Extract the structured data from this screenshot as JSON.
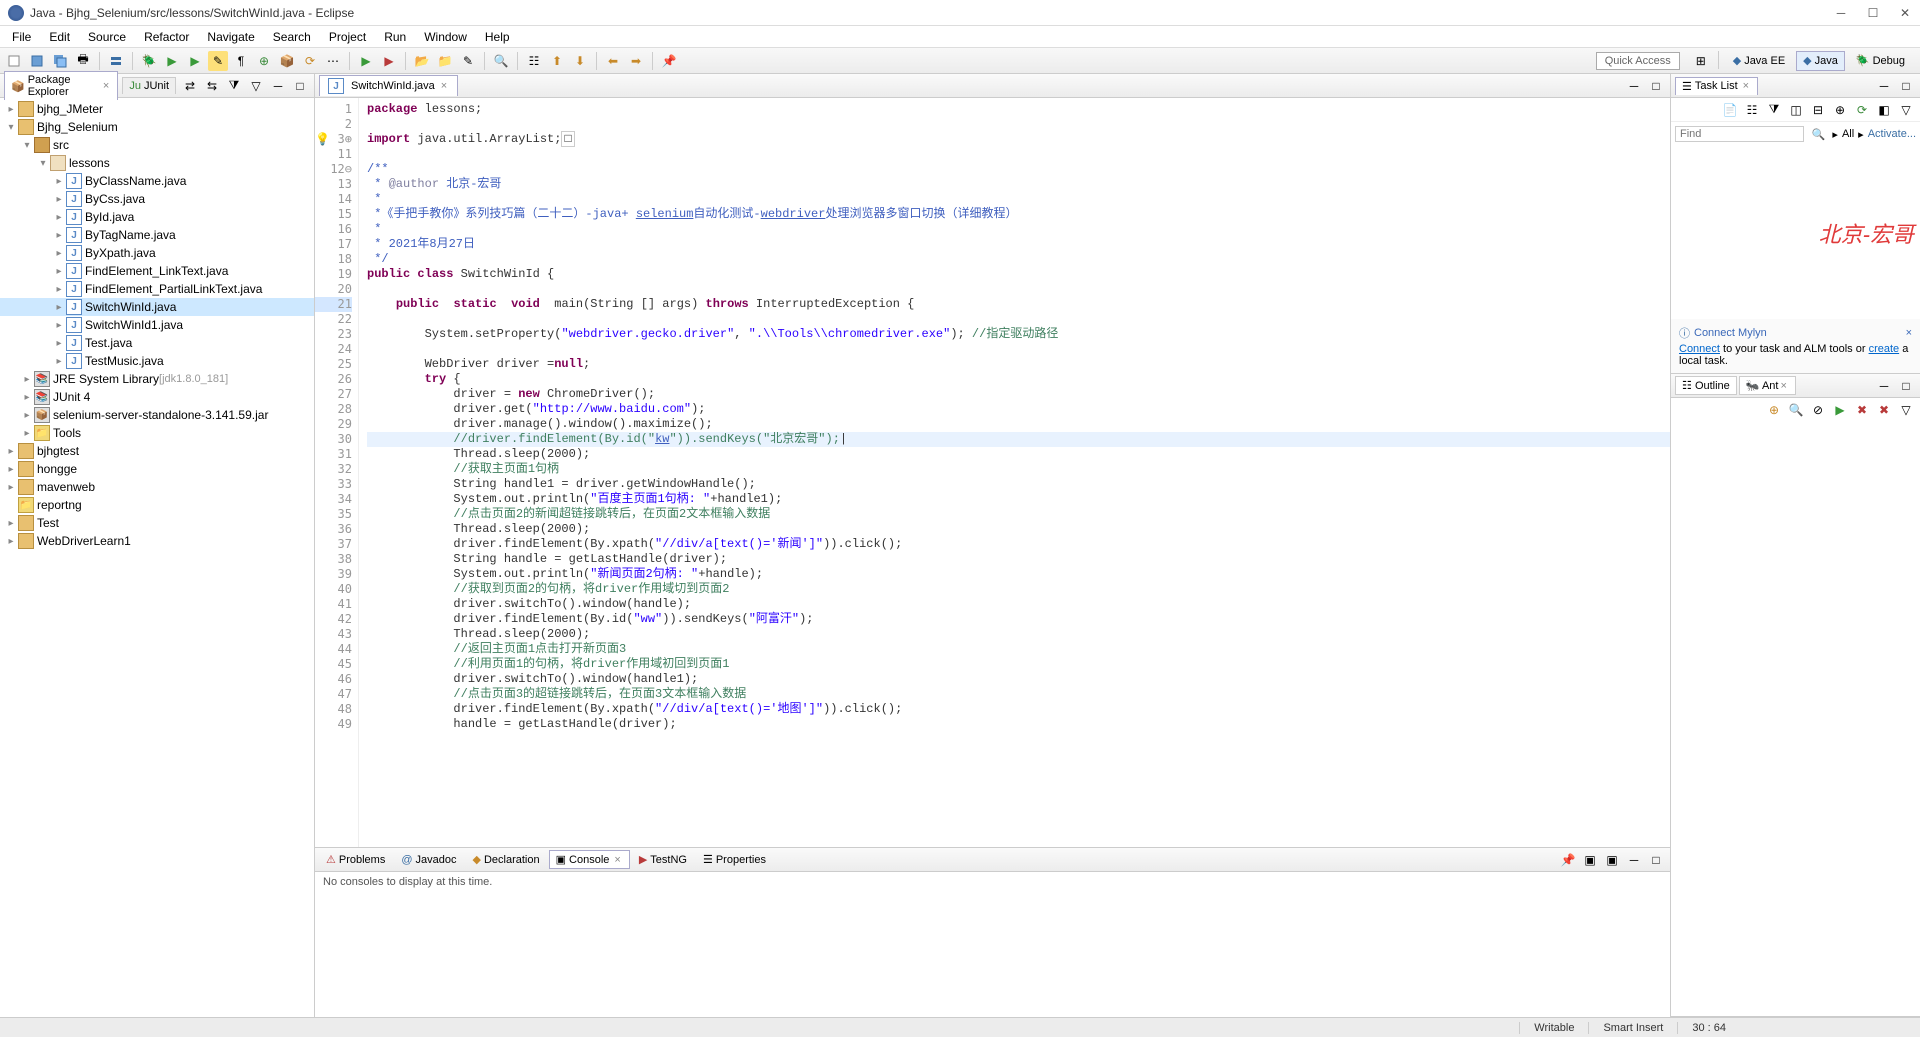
{
  "window": {
    "title": "Java - Bjhg_Selenium/src/lessons/SwitchWinId.java - Eclipse"
  },
  "menus": [
    "File",
    "Edit",
    "Source",
    "Refactor",
    "Navigate",
    "Search",
    "Project",
    "Run",
    "Window",
    "Help"
  ],
  "quick_access": "Quick Access",
  "perspectives": [
    {
      "label": "Java EE"
    },
    {
      "label": "Java"
    },
    {
      "label": "Debug"
    }
  ],
  "left": {
    "tab1": "Package Explorer",
    "tab2": "JUnit",
    "tree": {
      "p1": "bjhg_JMeter",
      "p2": "Bjhg_Selenium",
      "src": "src",
      "pkg": "lessons",
      "files": [
        "ByClassName.java",
        "ByCss.java",
        "ById.java",
        "ByTagName.java",
        "ByXpath.java",
        "FindElement_LinkText.java",
        "FindElement_PartialLinkText.java",
        "SwitchWinId.java",
        "SwitchWinId1.java",
        "Test.java",
        "TestMusic.java"
      ],
      "jre": "JRE System Library",
      "jre_deco": "[jdk1.8.0_181]",
      "junit": "JUnit 4",
      "selenium": "selenium-server-standalone-3.141.59.jar",
      "tools": "Tools",
      "others": [
        "bjhgtest",
        "hongge",
        "mavenweb",
        "reportng",
        "Test",
        "WebDriverLearn1"
      ]
    }
  },
  "editor": {
    "tab": "SwitchWinId.java",
    "lines": {
      "start": 1,
      "visible": [
        1,
        2,
        3,
        11,
        12,
        13,
        14,
        15,
        16,
        17,
        18,
        19,
        20,
        21,
        22,
        23,
        24,
        25,
        26,
        27,
        28,
        29,
        30,
        31,
        32,
        33,
        34,
        35,
        36,
        37,
        38,
        39,
        40,
        41,
        42,
        43,
        44,
        45,
        46,
        47,
        48,
        49
      ]
    },
    "code": {
      "l1_k": "package",
      "l1_t": " lessons;",
      "l3a": "import",
      "l3b": " java.util.ArrayList;",
      "l12": "/**",
      "l13a": " * ",
      "l13b": "@author",
      "l13c": " 北京-宏哥",
      "l14": " *",
      "l15a": " *《手把手教你》系列技巧篇（二十二）-java+ ",
      "l15b": "selenium",
      "l15c": "自动化测试-",
      "l15d": "webdriver",
      "l15e": "处理浏览器多窗口切换（详细教程）",
      "l16": " *",
      "l17": " * 2021年8月27日",
      "l18": " */",
      "l19a": "public",
      "l19b": "class",
      "l19c": " SwitchWinId {",
      "l21a": "public",
      "l21b": "static",
      "l21c": "void",
      "l21d": "  main(String [] args) ",
      "l21e": "throws",
      "l21f": " InterruptedException {",
      "l23a": "        System.setProperty(",
      "l23b": "\"webdriver.gecko.driver\"",
      "l23c": ", ",
      "l23d": "\".\\\\Tools\\\\chromedriver.exe\"",
      "l23e": "); ",
      "l23f": "//指定驱动路径",
      "l25a": "        WebDriver driver =",
      "l25b": "null",
      "l25c": ";",
      "l26a": "try",
      "l26b": " {",
      "l27a": "            driver = ",
      "l27b": "new",
      "l27c": " ChromeDriver();",
      "l28a": "            driver.get(",
      "l28b": "\"http://www.baidu.com\"",
      "l28c": ");",
      "l29": "            driver.manage().window().maximize();",
      "l30a": "//driver.findElement(By.id(\"",
      "l30b": "kw",
      "l30c": "\")).sendKeys(\"北京宏哥\");",
      "l31a": "            Thread.sleep(2000);",
      "l32": "//获取主页面1句柄",
      "l33": "            String handle1 = driver.getWindowHandle();",
      "l34a": "            System.out.println(",
      "l34b": "\"百度主页面1句柄: \"",
      "l34c": "+handle1);",
      "l35": "//点击页面2的新闻超链接跳转后，在页面2文本框输入数据",
      "l36": "            Thread.sleep(2000);",
      "l37a": "            driver.findElement(By.xpath(",
      "l37b": "\"//div/a[text()='新闻']\"",
      "l37c": ")).click();",
      "l38": "            String handle = getLastHandle(driver);",
      "l39a": "            System.out.println(",
      "l39b": "\"新闻页面2句柄: \"",
      "l39c": "+handle);",
      "l40": "//获取到页面2的句柄，将driver作用域切到页面2",
      "l41": "            driver.switchTo().window(handle);",
      "l42a": "            driver.findElement(By.id(",
      "l42b": "\"ww\"",
      "l42c": ")).sendKeys(",
      "l42d": "\"阿富汗\"",
      "l42e": ");",
      "l43": "            Thread.sleep(2000);",
      "l44": "//返回主页面1点击打开新页面3",
      "l45": "//利用页面1的句柄，将driver作用域初回到页面1",
      "l46": "            driver.switchTo().window(handle1);",
      "l47": "//点击页面3的超链接跳转后，在页面3文本框输入数据",
      "l48a": "            driver.findElement(By.xpath(",
      "l48b": "\"//div/a[text()='地图']\"",
      "l48c": ")).click();",
      "l49": "            handle = getLastHandle(driver);"
    }
  },
  "bottom": {
    "tabs": [
      "Problems",
      "Javadoc",
      "Declaration",
      "Console",
      "TestNG",
      "Properties"
    ],
    "msg": "No consoles to display at this time."
  },
  "right": {
    "tasklist": "Task List",
    "find_placeholder": "Find",
    "all": "All",
    "activate": "Activate...",
    "watermark": "北京-宏哥",
    "mylyn_title": "Connect Mylyn",
    "mylyn_connect": "Connect",
    "mylyn_mid": " to your task and ALM tools or ",
    "mylyn_create": "create",
    "mylyn_end": " a local task.",
    "outline": "Outline",
    "ant": "Ant"
  },
  "status": {
    "writable": "Writable",
    "insert": "Smart Insert",
    "pos": "30 : 64"
  }
}
